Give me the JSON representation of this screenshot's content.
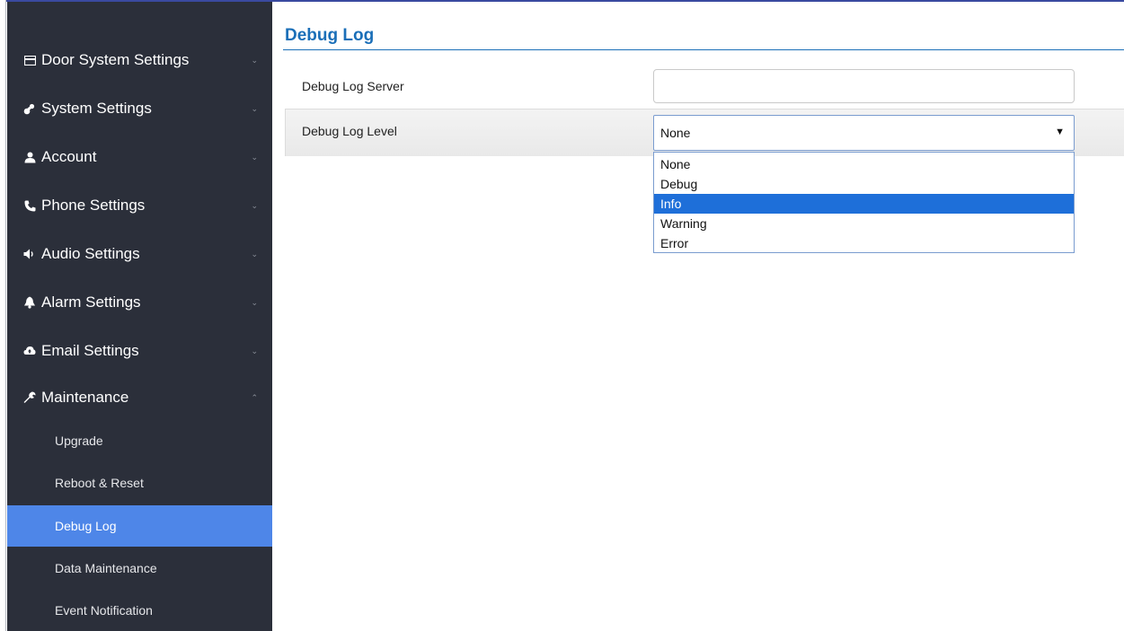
{
  "sidebar": {
    "items": [
      {
        "label": "Door System Settings",
        "icon": "card-icon",
        "expanded": false
      },
      {
        "label": "System Settings",
        "icon": "keys-icon",
        "expanded": false
      },
      {
        "label": "Account",
        "icon": "user-icon",
        "expanded": false
      },
      {
        "label": "Phone Settings",
        "icon": "phone-icon",
        "expanded": false
      },
      {
        "label": "Audio Settings",
        "icon": "speaker-icon",
        "expanded": false
      },
      {
        "label": "Alarm Settings",
        "icon": "bell-icon",
        "expanded": false
      },
      {
        "label": "Email Settings",
        "icon": "cloud-icon",
        "expanded": false
      },
      {
        "label": "Maintenance",
        "icon": "wrench-icon",
        "expanded": true
      }
    ],
    "subitems": [
      {
        "label": "Upgrade",
        "active": false
      },
      {
        "label": "Reboot & Reset",
        "active": false
      },
      {
        "label": "Debug Log",
        "active": true
      },
      {
        "label": "Data Maintenance",
        "active": false
      },
      {
        "label": "Event Notification",
        "active": false
      }
    ],
    "active_color": "#4e86e8",
    "bg_color": "#2b2f3a"
  },
  "main": {
    "title": "Debug Log",
    "server": {
      "label": "Debug Log Server",
      "value": ""
    },
    "level": {
      "label": "Debug Log Level",
      "selected": "None",
      "options": [
        "None",
        "Debug",
        "Info",
        "Warning",
        "Error"
      ],
      "highlighted": "Info"
    },
    "accent_color": "#1b6fb8"
  }
}
